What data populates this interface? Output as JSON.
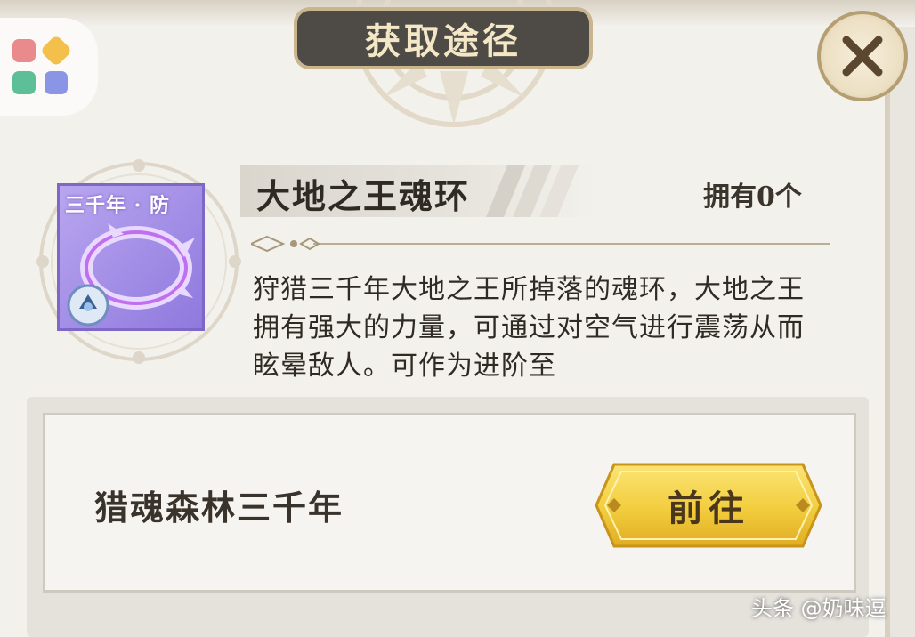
{
  "dialog": {
    "title": "获取途径",
    "close_icon": "close-x-icon"
  },
  "app_badge": {
    "icon": "app-grid-icon",
    "colors": [
      "#e98b8d",
      "#f3c04c",
      "#5dbf98",
      "#8b95e6"
    ]
  },
  "item": {
    "tag": "三千年 · 防",
    "icon": "soul-ring-icon",
    "name": "大地之王魂环",
    "owned": "拥有0个",
    "description": "狩猎三千年大地之王所掉落的魂环，大地之王拥有强大的力量，可通过对空气进行震荡从而眩晕敌人。可作为进阶至"
  },
  "sources": [
    {
      "name": "猎魂森林三千年",
      "button_label": "前往"
    }
  ],
  "watermark": "头条 @奶味逗",
  "colors": {
    "accent_gold": "#f2cd3d",
    "item_purple": "#9f88e4",
    "title_bg": "#4e4a46"
  }
}
